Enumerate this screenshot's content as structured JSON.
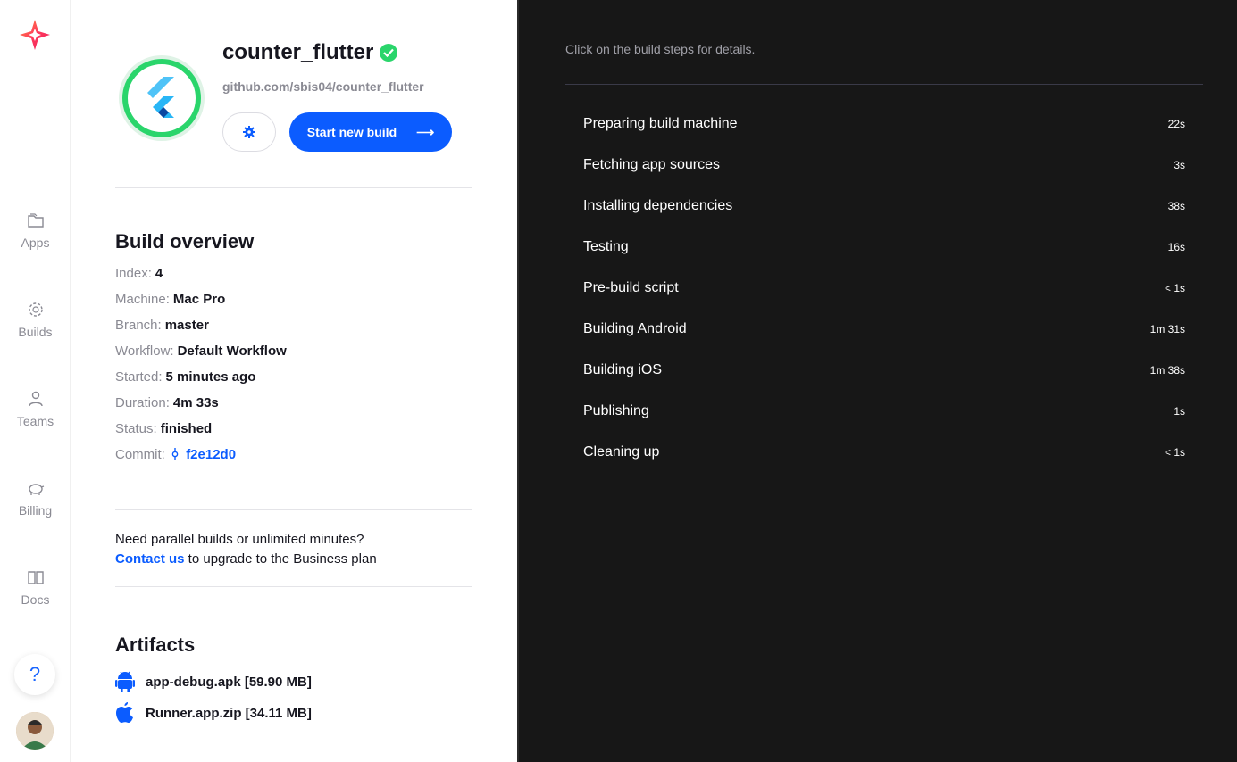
{
  "sidebar": {
    "items": [
      {
        "label": "Apps",
        "icon": "folder-icon"
      },
      {
        "label": "Builds",
        "icon": "builds-icon"
      },
      {
        "label": "Teams",
        "icon": "person-icon"
      },
      {
        "label": "Billing",
        "icon": "piggy-bank-icon"
      },
      {
        "label": "Docs",
        "icon": "book-icon"
      }
    ],
    "help_label": "?"
  },
  "app": {
    "name": "counter_flutter",
    "repo": "github.com/sbis04/counter_flutter",
    "start_build_label": "Start new build",
    "start_build_arrow": "⟶"
  },
  "overview": {
    "title": "Build overview",
    "rows": [
      {
        "label": "Index:",
        "value": "4"
      },
      {
        "label": "Machine:",
        "value": "Mac Pro"
      },
      {
        "label": "Branch:",
        "value": "master"
      },
      {
        "label": "Workflow:",
        "value": "Default Workflow"
      },
      {
        "label": "Started:",
        "value": "5 minutes ago"
      },
      {
        "label": "Duration:",
        "value": "4m 33s"
      },
      {
        "label": "Status:",
        "value": "finished"
      },
      {
        "label": "Commit:",
        "value": "f2e12d0"
      }
    ]
  },
  "upgrade": {
    "line1": "Need parallel builds or unlimited minutes?",
    "link": "Contact us",
    "line2": " to upgrade to the Business plan"
  },
  "artifacts": {
    "title": "Artifacts",
    "items": [
      {
        "name": "app-debug.apk [59.90 MB]",
        "icon": "android-icon"
      },
      {
        "name": "Runner.app.zip [34.11 MB]",
        "icon": "apple-icon"
      }
    ]
  },
  "steps": {
    "hint": "Click on the build steps for details.",
    "items": [
      {
        "name": "Preparing build machine",
        "duration": "22s"
      },
      {
        "name": "Fetching app sources",
        "duration": "3s"
      },
      {
        "name": "Installing dependencies",
        "duration": "38s"
      },
      {
        "name": "Testing",
        "duration": "16s"
      },
      {
        "name": "Pre-build script",
        "duration": "< 1s"
      },
      {
        "name": "Building Android",
        "duration": "1m 31s"
      },
      {
        "name": "Building iOS",
        "duration": "1m 38s"
      },
      {
        "name": "Publishing",
        "duration": "1s"
      },
      {
        "name": "Cleaning up",
        "duration": "< 1s"
      }
    ]
  },
  "colors": {
    "accent": "#0b5cff",
    "success": "#2ad56b",
    "dark_bg": "#171717"
  }
}
